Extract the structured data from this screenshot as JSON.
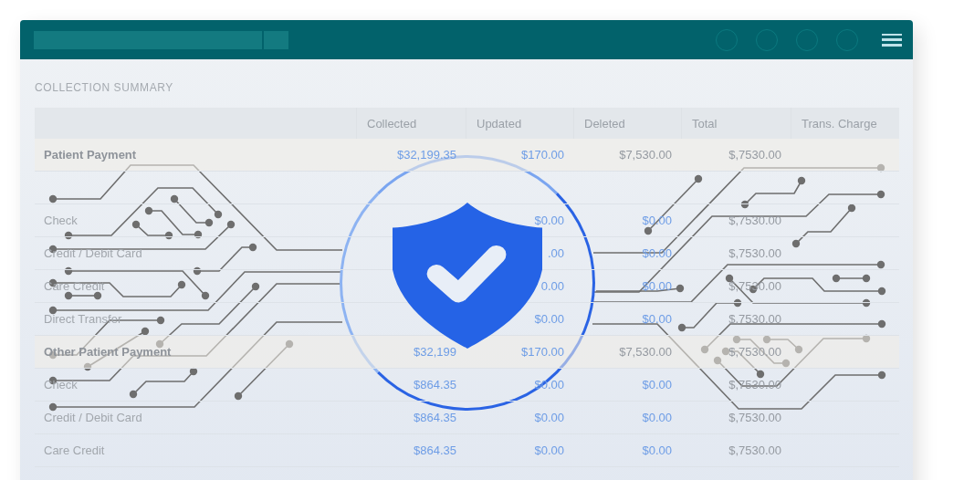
{
  "title": "COLLECTION SUMMARY",
  "columns": [
    "Collected",
    "Updated",
    "Deleted",
    "Total",
    "Trans. Charge"
  ],
  "rows": [
    {
      "kind": "group",
      "label": "Patient Payment",
      "collected": "$32,199.35",
      "updated": "$170.00",
      "deleted": "$7,530.00",
      "total": "$,7530.00"
    },
    {
      "kind": "item",
      "label": "Check",
      "updated": "$0.00",
      "deleted": "$0.00",
      "total": "$,7530.00"
    },
    {
      "kind": "item",
      "label": "Credit / Debit Card",
      "updated": ".00",
      "deleted": "$0.00",
      "total": "$,7530.00"
    },
    {
      "kind": "item",
      "label": "Care Credit",
      "updated": "0.00",
      "deleted": "$0.00",
      "total": "$,7530.00"
    },
    {
      "kind": "item",
      "label": "Direct Transfer",
      "updated": "$0.00",
      "deleted": "$0.00",
      "total": "$,7530.00"
    },
    {
      "kind": "group",
      "label": "Other Patient Payment",
      "collected": "$32,199",
      "updated": "$170.00",
      "deleted": "$7,530.00",
      "total": "$,7530.00"
    },
    {
      "kind": "item",
      "label": "Check",
      "collected": "$864.35",
      "updated": "$0.00",
      "deleted": "$0.00",
      "total": "$,7530.00"
    },
    {
      "kind": "item",
      "label": "Credit / Debit Card",
      "collected": "$864.35",
      "updated": "$0.00",
      "deleted": "$0.00",
      "total": "$,7530.00"
    },
    {
      "kind": "item",
      "label": "Care Credit",
      "collected": "$864.35",
      "updated": "$0.00",
      "deleted": "$0.00",
      "total": "$,7530.00"
    }
  ]
}
